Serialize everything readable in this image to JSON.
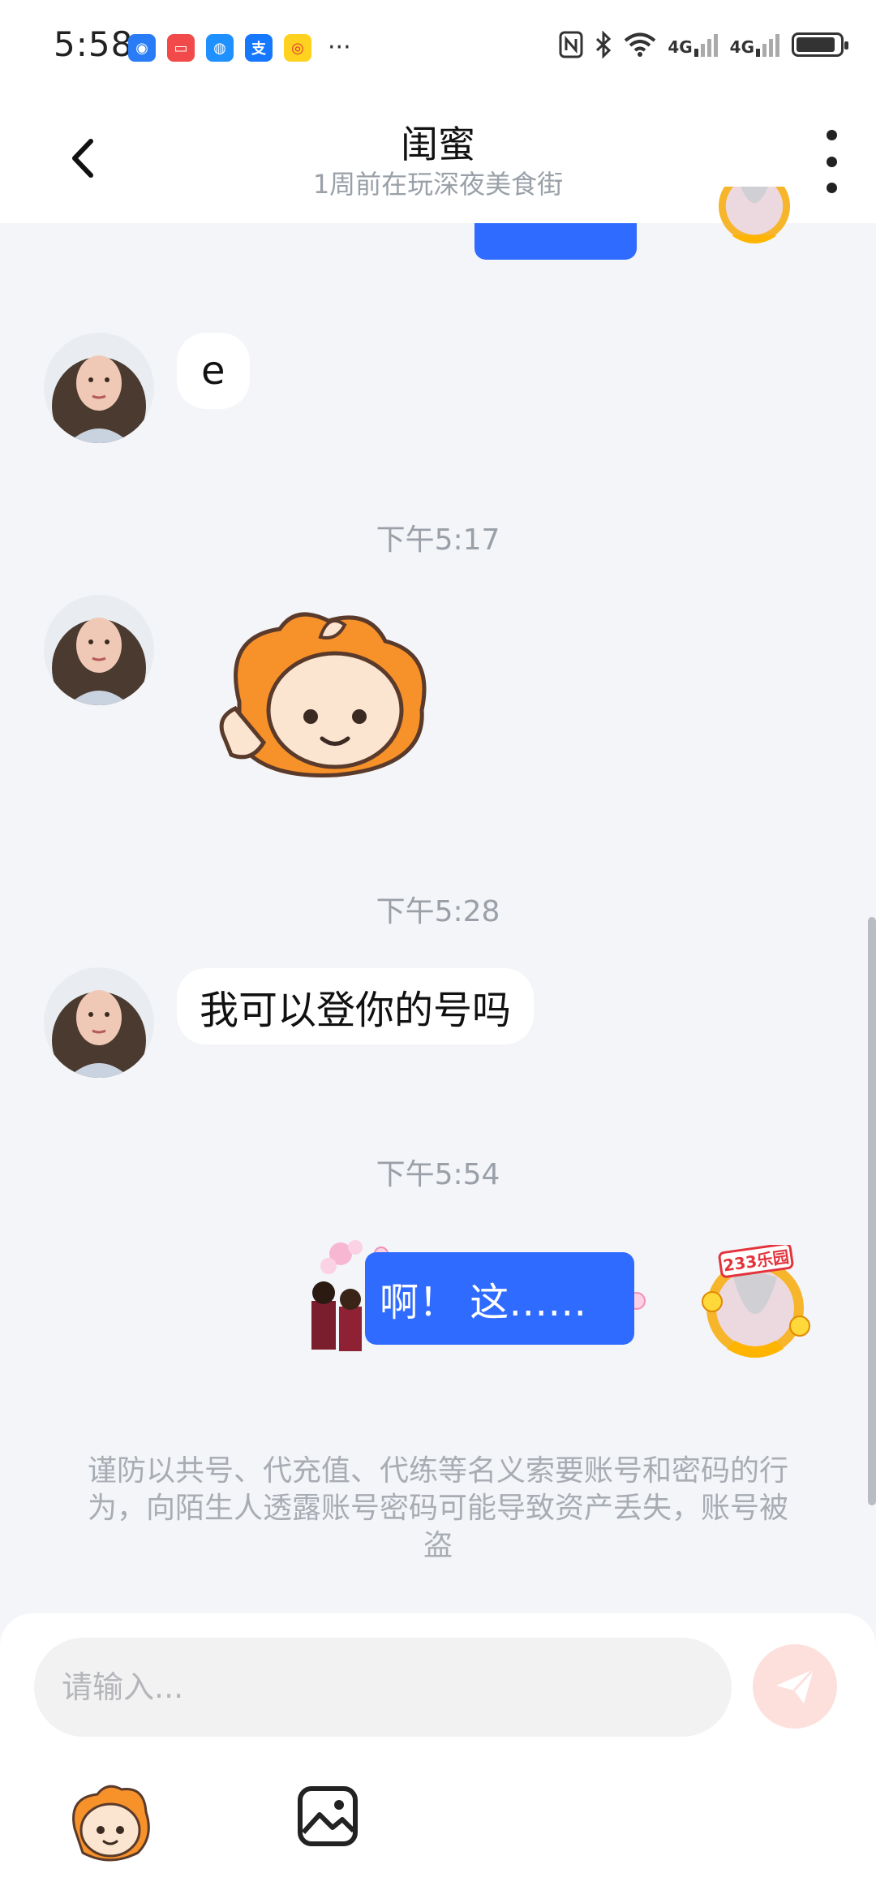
{
  "status_bar": {
    "time": "5:58",
    "more": "···",
    "signal_1": "4G",
    "signal_2": "4G",
    "battery_level": 0.9
  },
  "header": {
    "title": "闺蜜",
    "subtitle": "1周前在玩深夜美食街"
  },
  "messages": [
    {
      "type": "text",
      "side": "left",
      "text": "e"
    },
    {
      "type": "timestamp",
      "text": "下午5:17"
    },
    {
      "type": "sticker",
      "side": "left",
      "sticker": "face-sticker"
    },
    {
      "type": "timestamp",
      "text": "下午5:28"
    },
    {
      "type": "text",
      "side": "left",
      "text": "我可以登你的号吗"
    },
    {
      "type": "timestamp",
      "text": "下午5:54"
    },
    {
      "type": "text",
      "side": "right",
      "text": "啊！ 这……"
    }
  ],
  "avatar_badge": "233乐园",
  "notice": "谨防以共号、代充值、代练等名义索要账号和密码的行为，向陌生人透露账号密码可能导致资产丢失，账号被盗",
  "composer": {
    "placeholder": "请输入..."
  },
  "colors": {
    "accent": "#2f6bff",
    "send_button": "#fde0dc",
    "background": "#f4f5f9"
  }
}
